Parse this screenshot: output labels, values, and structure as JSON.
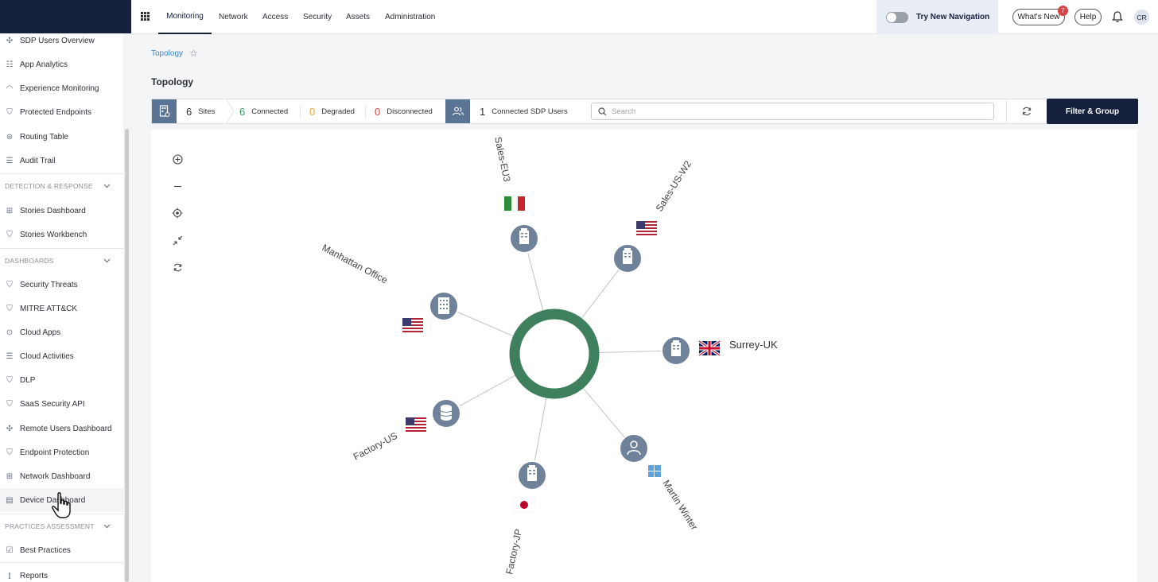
{
  "sidebar": {
    "items": [
      {
        "label": "SDP Users Overview",
        "icon": "dots-icon"
      },
      {
        "label": "App Analytics",
        "icon": "grid-icon"
      },
      {
        "label": "Experience Monitoring",
        "icon": "gauge-icon"
      },
      {
        "label": "Protected Endpoints",
        "icon": "shield-icon"
      },
      {
        "label": "Routing Table",
        "icon": "routing-icon"
      },
      {
        "label": "Audit Trail",
        "icon": "list-icon"
      }
    ],
    "section_detection": "DETECTION & RESPONSE",
    "detection_items": [
      {
        "label": "Stories Dashboard",
        "icon": "grid-icon"
      },
      {
        "label": "Stories Workbench",
        "icon": "shield-icon"
      }
    ],
    "section_dashboards": "DASHBOARDS",
    "dashboard_items": [
      {
        "label": "Security Threats",
        "icon": "shield-icon"
      },
      {
        "label": "MITRE ATT&CK",
        "icon": "shield-icon"
      },
      {
        "label": "Cloud Apps",
        "icon": "cloud-icon"
      },
      {
        "label": "Cloud Activities",
        "icon": "list-icon"
      },
      {
        "label": "DLP",
        "icon": "shield-icon"
      },
      {
        "label": "SaaS Security API",
        "icon": "shield-icon"
      },
      {
        "label": "Remote Users Dashboard",
        "icon": "dots-icon"
      },
      {
        "label": "Endpoint Protection",
        "icon": "shield-icon"
      },
      {
        "label": "Network Dashboard",
        "icon": "grid-icon"
      },
      {
        "label": "Device Dashboard",
        "icon": "device-icon"
      }
    ],
    "section_practices": "PRACTICES ASSESSMENT",
    "practices_items": [
      {
        "label": "Best Practices",
        "icon": "checkbox-icon"
      }
    ],
    "reports_label": "Reports"
  },
  "topbar": {
    "tabs": [
      "Monitoring",
      "Network",
      "Access",
      "Security",
      "Assets",
      "Administration"
    ],
    "active_tab": "Monitoring",
    "try_new_nav": "Try New Navigation",
    "whats_new": "What's New",
    "whats_new_badge": "7",
    "help": "Help",
    "avatar_initials": "CR"
  },
  "breadcrumb": "Topology",
  "page_title": "Topology",
  "stats": {
    "sites_count": "6",
    "sites_label": "Sites",
    "connected_count": "6",
    "connected_label": "Connected",
    "degraded_count": "0",
    "degraded_label": "Degraded",
    "disconnected_count": "0",
    "disconnected_label": "Disconnected",
    "sdp_users_count": "1",
    "sdp_users_label": "Connected SDP Users",
    "search_placeholder": "Search",
    "filter_button": "Filter & Group"
  },
  "colors": {
    "navy": "#14203c",
    "connected": "#3d9b6c",
    "degraded": "#f0a23a",
    "disconnected": "#d64545",
    "hub": "#3e805e",
    "node": "#6f8299",
    "link": "#3a86c8"
  },
  "topology": {
    "nodes": [
      {
        "name": "Sales-EU3",
        "type": "site",
        "flag": "italy-flag"
      },
      {
        "name": "Sales-US-W2",
        "type": "site",
        "flag": "usa-flag"
      },
      {
        "name": "Manhattan Office",
        "type": "site",
        "flag": "usa-flag"
      },
      {
        "name": "Surrey-UK",
        "type": "site",
        "flag": "uk-flag"
      },
      {
        "name": "Factory-US",
        "type": "datacenter",
        "flag": "usa-flag"
      },
      {
        "name": "Factory-JP",
        "type": "site",
        "flag": "japan-flag"
      },
      {
        "name": "Martin Winter",
        "type": "user",
        "flag": "windows-icon"
      }
    ]
  }
}
